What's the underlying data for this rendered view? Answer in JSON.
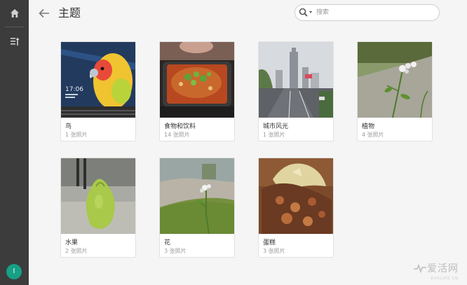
{
  "sidebar": {
    "items": [
      {
        "icon": "home-icon"
      },
      {
        "icon": "sort-icon"
      }
    ],
    "avatar_initial": "I"
  },
  "header": {
    "title": "主题",
    "back_icon": "back-arrow-icon"
  },
  "search": {
    "placeholder": "搜索",
    "value": ""
  },
  "categories": [
    {
      "name": "鸟",
      "count": "1 张照片"
    },
    {
      "name": "食物和饮料",
      "count": "14 张照片"
    },
    {
      "name": "城市风光",
      "count": "1 张照片"
    },
    {
      "name": "植物",
      "count": "4 张照片"
    },
    {
      "name": "水果",
      "count": "2 张照片"
    },
    {
      "name": "花",
      "count": "3 张照片"
    },
    {
      "name": "蛋糕",
      "count": "3 张照片"
    }
  ],
  "thumb_texts": {
    "clock_time": "17:06"
  },
  "watermark": {
    "text": "爱活网",
    "subtext": "EVOLIFE.CN"
  },
  "colors": {
    "sidebar": "#3c3c3c",
    "accent": "#16a085",
    "background": "#f5f5f5"
  }
}
